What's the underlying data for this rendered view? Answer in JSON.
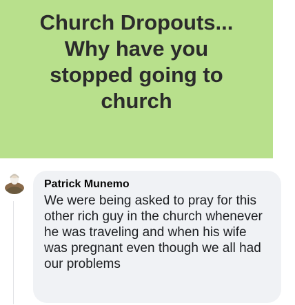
{
  "post": {
    "text": "Church Dropouts...\nWhy have you\nstopped going to\nchurch",
    "background_color": "#b8e08c"
  },
  "comment": {
    "author": "Patrick Munemo",
    "text": "We were being asked to pray for this other rich guy in the church whenever he was traveling and when his wife was pregnant even though we all had our problems",
    "avatar_icon": "user-avatar-icon"
  }
}
